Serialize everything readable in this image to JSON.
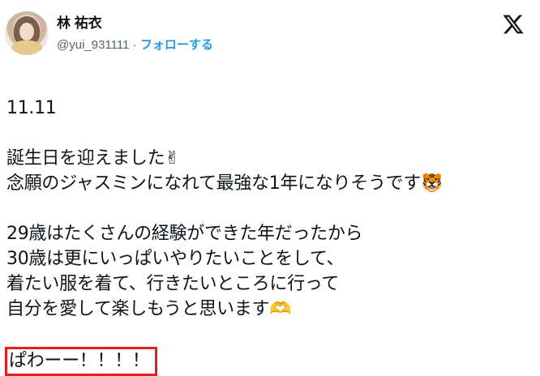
{
  "account": {
    "name": "林 祐衣",
    "handle": "@yui_931111",
    "separator": " · ",
    "follow_label": "フォローする"
  },
  "icons": {
    "avatar": "profile-photo",
    "logo": "x-logo-icon"
  },
  "tweet": {
    "lines": [
      "11.11",
      "",
      "誕生日を迎えました✌",
      "念願のジャスミンになれて最強な1年になりそうです🐯",
      "",
      "29歳はたくさんの経験ができた年だったから",
      "30歳は更にいっぱいやりたいことをして、",
      "着たい服を着て、行きたいところに行って",
      "自分を愛して楽しもうと思います🫶",
      ""
    ],
    "highlighted_line": "ぱわーー！！！！"
  },
  "colors": {
    "text": "#0f1419",
    "secondary": "#536471",
    "follow": "#1d9bf0",
    "highlight_border": "#e02020"
  }
}
